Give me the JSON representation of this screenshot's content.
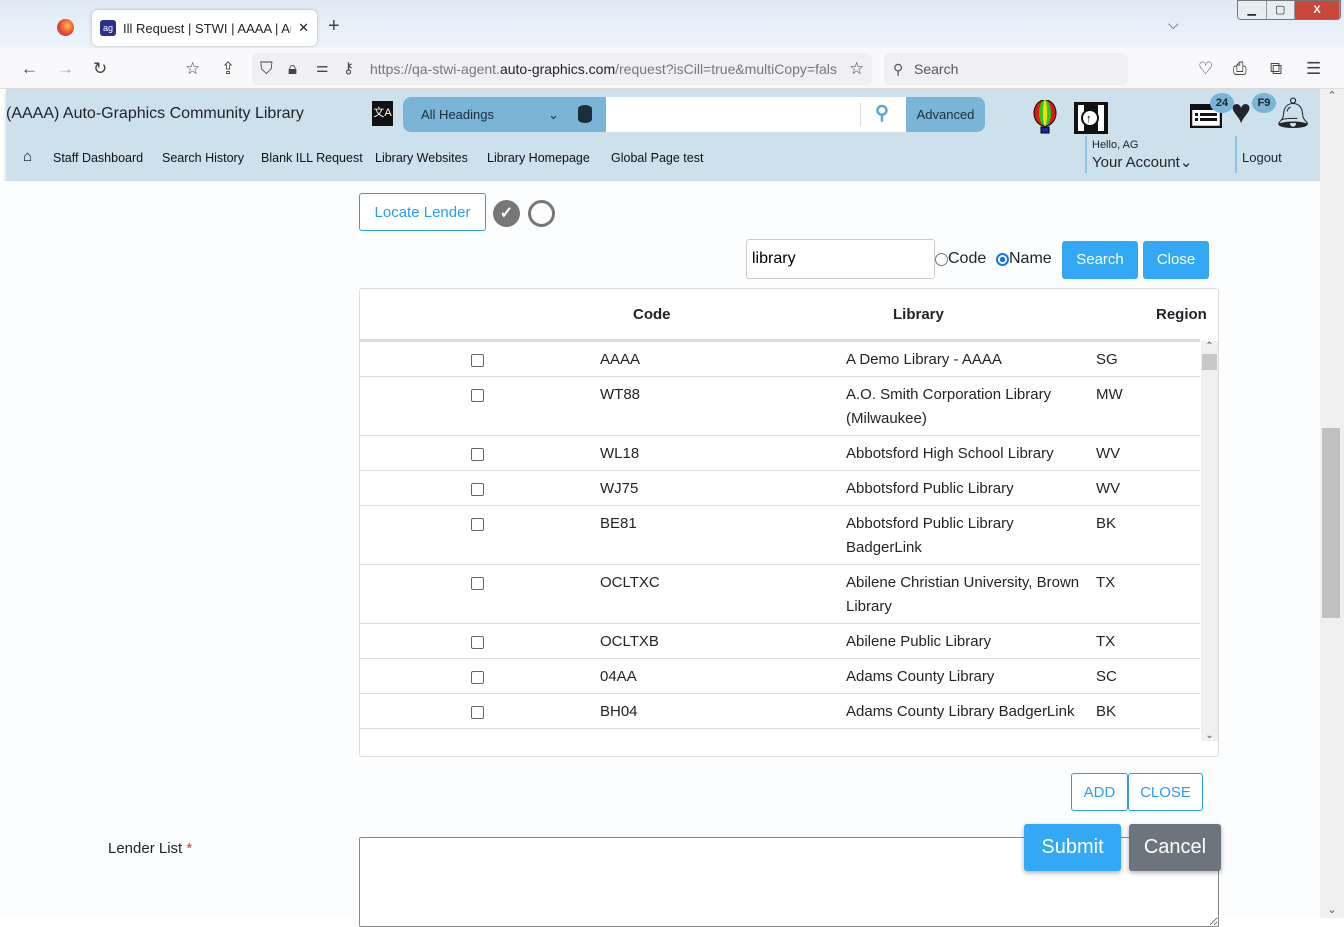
{
  "browser": {
    "tab_title": "Ill Request | STWI | AAAA | Auto",
    "url_prefix": "https://qa-stwi-agent.",
    "url_domain": "auto-graphics.com",
    "url_suffix": "/request?isCill=true&multiCopy=fals",
    "search_placeholder": "Search"
  },
  "header": {
    "library_name": "(AAAA) Auto-Graphics Community Library",
    "search_scope": "All Headings",
    "advanced_label": "Advanced",
    "list_badge": "24",
    "favorites_badge": "F9",
    "greeting": "Hello, AG",
    "account_label": "Your Account",
    "logout_label": "Logout",
    "nav": [
      "Staff Dashboard",
      "Search History",
      "Blank ILL Request",
      "Library Websites",
      "Library Homepage",
      "Global Page test"
    ]
  },
  "lender_search": {
    "locate_label": "Locate Lender",
    "query": "library",
    "radio_code": "Code",
    "radio_name": "Name",
    "selected": "Name",
    "search_label": "Search",
    "close_label": "Close"
  },
  "table": {
    "columns": [
      "Code",
      "Library",
      "Region"
    ],
    "rows": [
      {
        "code": "AAAA",
        "library": "A Demo Library - AAAA",
        "region": "SG"
      },
      {
        "code": "WT88",
        "library": "A.O. Smith Corporation Library (Milwaukee)",
        "region": "MW"
      },
      {
        "code": "WL18",
        "library": "Abbotsford High School Library",
        "region": "WV"
      },
      {
        "code": "WJ75",
        "library": "Abbotsford Public Library",
        "region": "WV"
      },
      {
        "code": "BE81",
        "library": "Abbotsford Public Library BadgerLink",
        "region": "BK"
      },
      {
        "code": "OCLTXC",
        "library": "Abilene Christian University, Brown Library",
        "region": "TX"
      },
      {
        "code": "OCLTXB",
        "library": "Abilene Public Library",
        "region": "TX"
      },
      {
        "code": "04AA",
        "library": "Adams County Library",
        "region": "SC"
      },
      {
        "code": "BH04",
        "library": "Adams County Library BadgerLink",
        "region": "BK"
      }
    ],
    "add_label": "ADD",
    "close_label": "CLOSE"
  },
  "form": {
    "lender_list_label": "Lender List",
    "required_mark": "*",
    "submit_label": "Submit",
    "cancel_label": "Cancel"
  },
  "colors": {
    "accent": "#33a8f5",
    "header_bg": "#cde1ec",
    "search_bar": "#7ab4d6",
    "cancel": "#6c757d"
  }
}
